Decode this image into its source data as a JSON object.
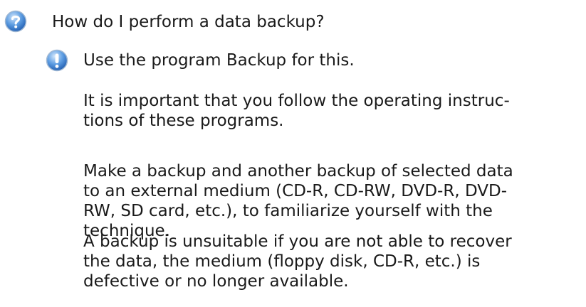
{
  "faq": {
    "question_icon": "question-mark-icon",
    "answer_icon": "exclamation-info-icon",
    "question": "How do I perform a data backup?",
    "answer": [
      {
        "lines": [
          "Use the program Backup for this."
        ]
      },
      {
        "lines": [
          "It is important that you follow the operating instruc-",
          "tions of these programs."
        ]
      },
      {
        "lines": [
          "Make a backup and another backup of selected data",
          "to an external medium (CD-R, CD-RW, DVD-R, DVD-",
          "RW, SD card, etc.), to familiarize yourself with the",
          "technique."
        ]
      },
      {
        "lines": [
          "A backup is unsuitable if you are not able to recover",
          "the data, the medium (floppy disk, CD-R, etc.) is",
          "defective or no longer available."
        ]
      }
    ]
  },
  "colors": {
    "icon_blue": "#2f78c8",
    "icon_light": "#9cc6f0",
    "text": "#1a1a1a"
  }
}
